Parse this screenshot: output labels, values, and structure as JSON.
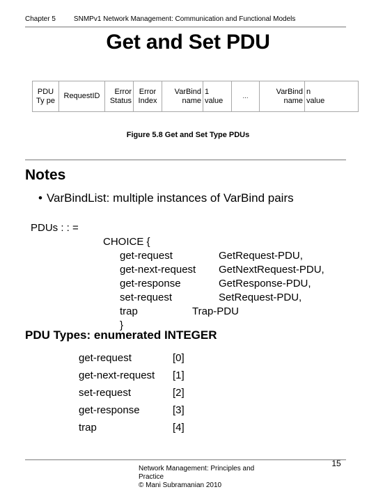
{
  "header": {
    "chapter": "Chapter 5",
    "title": "SNMPv1 Network Management: Communication and Functional Models"
  },
  "slide": {
    "title": "Get and Set PDU",
    "figure_caption": "Figure 5.8 Get and Set Type PDUs"
  },
  "pdu_table": {
    "cells": [
      {
        "name": "pdu-type",
        "line1": "PDU",
        "line2": "Ty pe",
        "align": "center"
      },
      {
        "name": "request-id",
        "line1": "RequestID",
        "line2": "",
        "align": "center"
      },
      {
        "name": "error-status",
        "line1": "Error",
        "line2": "Status",
        "align": "right"
      },
      {
        "name": "error-index",
        "line1": "Error",
        "line2": "Index",
        "align": "center"
      },
      {
        "name": "varbind1-name",
        "line1": "VarBind",
        "line2": "name",
        "align": "right"
      },
      {
        "name": "varbind1-value",
        "line1": "1",
        "line2": "value",
        "align": "left"
      },
      {
        "name": "ellipsis",
        "line1": "...",
        "line2": "",
        "align": "center"
      },
      {
        "name": "varbindn-name",
        "line1": "VarBind",
        "line2": "name",
        "align": "right"
      },
      {
        "name": "varbindn-value",
        "line1": "n",
        "line2": "value",
        "align": "left"
      }
    ]
  },
  "notes": {
    "heading": "Notes",
    "bullet_marker": "•",
    "bullet_text": "VarBindList: multiple instances of VarBind pairs"
  },
  "asn1": {
    "decl": "PDUs : : =",
    "choice_open": "CHOICE {",
    "choice_close": "}",
    "entries": [
      {
        "name": "get-request",
        "type": "GetRequest-PDU,"
      },
      {
        "name": "get-next-request",
        "type": "GetNextRequest-PDU,"
      },
      {
        "name": "get-response",
        "type": "GetResponse-PDU,"
      },
      {
        "name": "set-request",
        "type": "SetRequest-PDU,"
      },
      {
        "name": "trap",
        "type": "Trap-PDU"
      }
    ]
  },
  "pdu_types": {
    "heading": "PDU Types: enumerated INTEGER",
    "rows": [
      {
        "name": "get-request",
        "code": "[0]"
      },
      {
        "name": "get-next-request",
        "code": "[1]"
      },
      {
        "name": "set-request",
        "code": "[2]"
      },
      {
        "name": "get-response",
        "code": "[3]"
      },
      {
        "name": "trap",
        "code": "[4]"
      }
    ]
  },
  "footer": {
    "line1": "Network Management: Principles and",
    "line2": "Practice",
    "line3": "© Mani Subramanian 2010",
    "page_number": "15"
  }
}
